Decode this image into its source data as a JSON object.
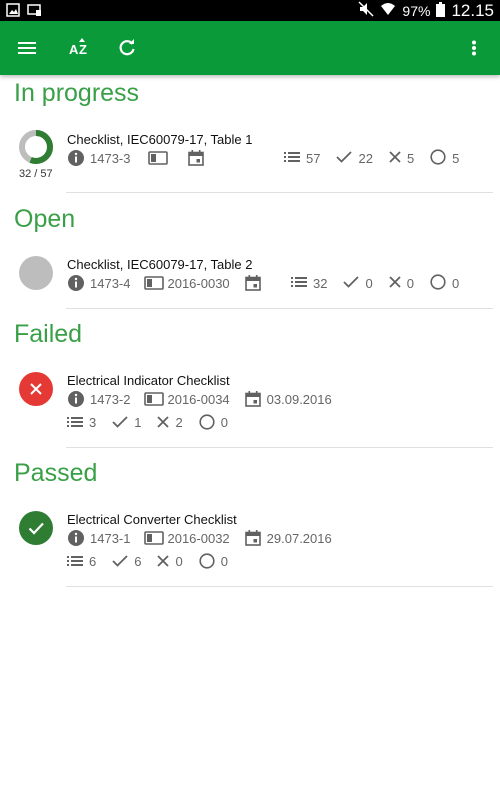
{
  "status_bar": {
    "battery": "97%",
    "time": "12.15"
  },
  "toolbar": {
    "menu_icon": "menu-icon",
    "sort_icon": "sort-az-icon",
    "refresh_icon": "refresh-icon",
    "more_icon": "more-vert-icon"
  },
  "colors": {
    "primary": "#0a9a3a",
    "section_title": "#3aa048",
    "failed": "#e53935",
    "passed": "#2e7d32",
    "open": "#bdbdbd"
  },
  "sections": [
    {
      "title": "In progress",
      "items": [
        {
          "name": "Checklist, IEC60079-17, Table 1",
          "id": "1473-3",
          "order": "",
          "date": "",
          "progress": "32 / 57",
          "progress_done": 32,
          "progress_total": 57,
          "stats": {
            "total": "57",
            "passed": "22",
            "failed": "5",
            "open": "5"
          }
        }
      ]
    },
    {
      "title": "Open",
      "items": [
        {
          "name": "Checklist, IEC60079-17, Table 2",
          "id": "1473-4",
          "order": "2016-0030",
          "date": "",
          "stats": {
            "total": "32",
            "passed": "0",
            "failed": "0",
            "open": "0"
          }
        }
      ]
    },
    {
      "title": "Failed",
      "items": [
        {
          "name": "Electrical Indicator Checklist",
          "id": "1473-2",
          "order": "2016-0034",
          "date": "03.09.2016",
          "stats": {
            "total": "3",
            "passed": "1",
            "failed": "2",
            "open": "0"
          }
        }
      ]
    },
    {
      "title": "Passed",
      "items": [
        {
          "name": "Electrical Converter Checklist",
          "id": "1473-1",
          "order": "2016-0032",
          "date": "29.07.2016",
          "stats": {
            "total": "6",
            "passed": "6",
            "failed": "0",
            "open": "0"
          }
        }
      ]
    }
  ]
}
